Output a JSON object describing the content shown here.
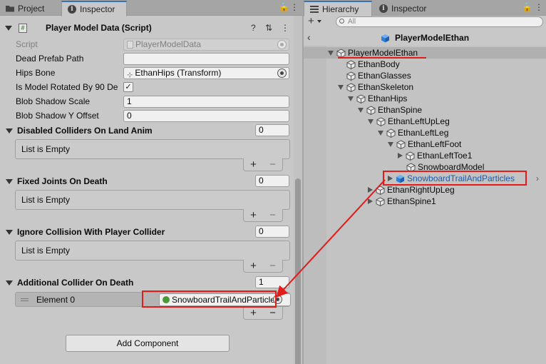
{
  "left_tabs": {
    "project": "Project",
    "inspector": "Inspector",
    "lock": "🔒",
    "menu": "⋮"
  },
  "right_tabs": {
    "hierarchy": "Hierarchy",
    "inspector": "Inspector",
    "lock": "🔒",
    "menu": "⋮"
  },
  "component": {
    "title": "Player Model Data (Script)",
    "script_badge": "#",
    "help": "?",
    "settings": "⇅",
    "menu": "⋮"
  },
  "fields": {
    "script_label": "Script",
    "script_value": "PlayerModelData",
    "dead_prefab_label": "Dead Prefab Path",
    "dead_prefab_value": "",
    "hips_label": "Hips Bone",
    "hips_value": "EthanHips (Transform)",
    "rotated_label": "Is Model Rotated By 90 De",
    "rotated_check": "✓",
    "blob_scale_label": "Blob Shadow Scale",
    "blob_scale_value": "1",
    "blob_y_label": "Blob Shadow Y Offset",
    "blob_y_value": "0"
  },
  "lists": {
    "disabled_colliders": {
      "title": "Disabled Colliders On Land Anim",
      "count": "0",
      "empty": "List is Empty"
    },
    "fixed_joints": {
      "title": "Fixed Joints On Death",
      "count": "0",
      "empty": "List is Empty"
    },
    "ignore_collision": {
      "title": "Ignore Collision With Player Collider",
      "count": "0",
      "empty": "List is Empty"
    },
    "additional_collider": {
      "title": "Additional Collider On Death",
      "count": "1",
      "element_label": "Element 0",
      "element_value": "SnowboardTrailAndParticles"
    },
    "plus": "+",
    "minus": "−"
  },
  "add_component": "Add Component",
  "hierarchy": {
    "add": "+",
    "search_placeholder": "All",
    "back": "‹",
    "prefab_title": "PlayerModelEthan",
    "items": [
      {
        "label": "PlayerModelEthan"
      },
      {
        "label": "EthanBody"
      },
      {
        "label": "EthanGlasses"
      },
      {
        "label": "EthanSkeleton"
      },
      {
        "label": "EthanHips"
      },
      {
        "label": "EthanSpine"
      },
      {
        "label": "EthanLeftUpLeg"
      },
      {
        "label": "EthanLeftLeg"
      },
      {
        "label": "EthanLeftFoot"
      },
      {
        "label": "EthanLeftToe1"
      },
      {
        "label": "SnowboardModel"
      },
      {
        "label": "SnowboardTrailAndParticles"
      },
      {
        "label": "EthanRightUpLeg"
      },
      {
        "label": "EthanSpine1"
      }
    ],
    "row_chevron": "›"
  },
  "colors": {
    "highlight": "#e21b1b",
    "link_blue": "#1e5aab",
    "tab_accent": "#3a72b0"
  }
}
